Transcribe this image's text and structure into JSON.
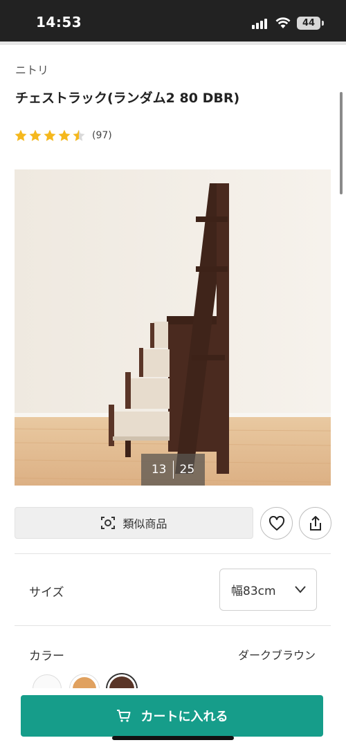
{
  "status_bar": {
    "time": "14:53",
    "battery": "44"
  },
  "product": {
    "brand": "ニトリ",
    "title": "チェストラック(ランダム2 80 DBR)",
    "rating": 4.5,
    "review_count": "(97)",
    "image_index": "13",
    "image_total": "25"
  },
  "actions": {
    "similar_label": "類似商品",
    "favorite_icon": "heart-icon",
    "share_icon": "share-icon"
  },
  "options": {
    "size_label": "サイズ",
    "size_value": "幅83cm",
    "color_label": "カラー",
    "color_value": "ダークブラウン",
    "swatches": [
      {
        "name": "white",
        "color": "#fafafa"
      },
      {
        "name": "natural",
        "color": "#e0a15f"
      },
      {
        "name": "dark-brown",
        "color": "#5a3527",
        "selected": true
      }
    ]
  },
  "cart": {
    "label": "カートに入れる",
    "color": "#169d8a"
  }
}
